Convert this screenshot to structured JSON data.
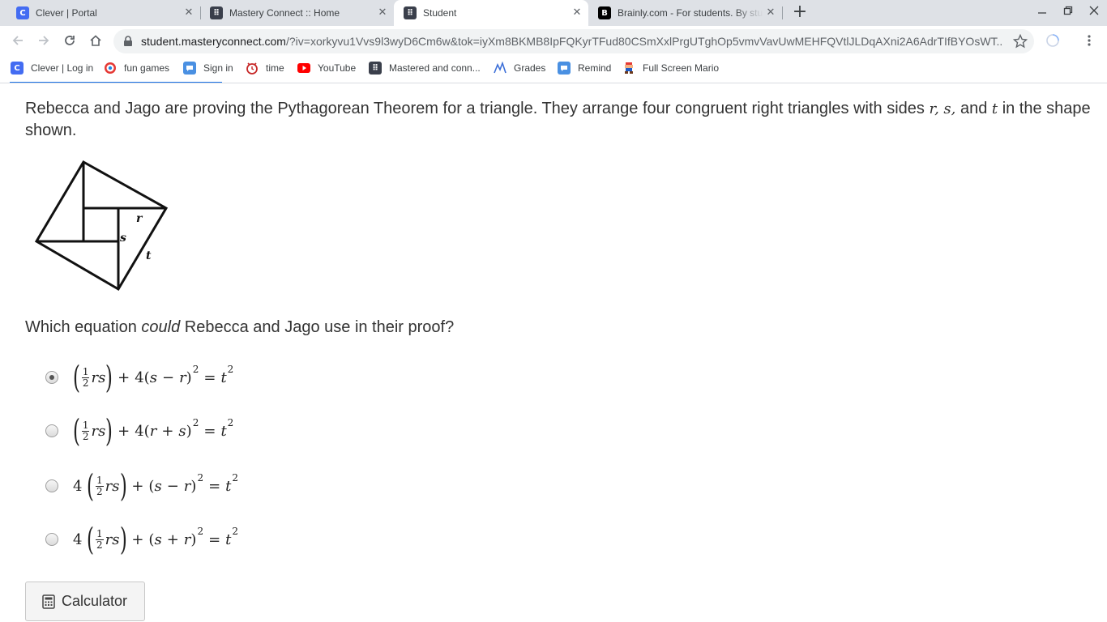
{
  "browser": {
    "tabs": [
      {
        "title": "Clever | Portal",
        "icon": "clever-icon",
        "active": false
      },
      {
        "title": "Mastery Connect :: Home",
        "icon": "masteryconnect-icon",
        "active": false
      },
      {
        "title": "Student",
        "icon": "masteryconnect-icon",
        "active": true
      },
      {
        "title": "Brainly.com - For students. By students",
        "icon": "brainly-icon",
        "active": false
      }
    ],
    "url_host": "student.masteryconnect.com",
    "url_rest": "/?iv=xorkyvu1Vvs9l3wyD6Cm6w&tok=iyXm8BKMB8IpFQKyrTFud80CSmXxlPrgUTghOp5vmvVavUwMEHFQVtlJLDqAXni2A6AdrTIfBYOsWT...",
    "bookmarks": [
      {
        "label": "Clever | Log in",
        "icon": "clever-icon"
      },
      {
        "label": "fun games",
        "icon": "target-icon"
      },
      {
        "label": "Sign in",
        "icon": "remind-icon"
      },
      {
        "label": "time",
        "icon": "clock-icon"
      },
      {
        "label": "YouTube",
        "icon": "youtube-icon"
      },
      {
        "label": "Mastered and conn...",
        "icon": "masteryconnect-icon"
      },
      {
        "label": "Grades",
        "icon": "grades-icon"
      },
      {
        "label": "Remind",
        "icon": "remind-icon"
      },
      {
        "label": "Full Screen Mario",
        "icon": "mario-icon"
      }
    ]
  },
  "question": {
    "text_1": "Rebecca and Jago are proving the Pythagorean Theorem for a triangle. They arrange four congruent right triangles with sides ",
    "var_r": "r",
    "comma": ",",
    "var_s": "s",
    "and": "and",
    "var_t": "t",
    "text_2": "in the shape",
    "text_3": "shown.",
    "diagram_labels": {
      "r": "r",
      "s": "s",
      "t": "t"
    },
    "prompt_before": "Which equation ",
    "prompt_em": "could",
    "prompt_after": " Rebecca and Jago use in their proof?",
    "selected_index": 0
  },
  "calculator_label": "Calculator",
  "colors": {
    "accent": "#1a73e8",
    "tabstrip": "#dee1e6"
  }
}
